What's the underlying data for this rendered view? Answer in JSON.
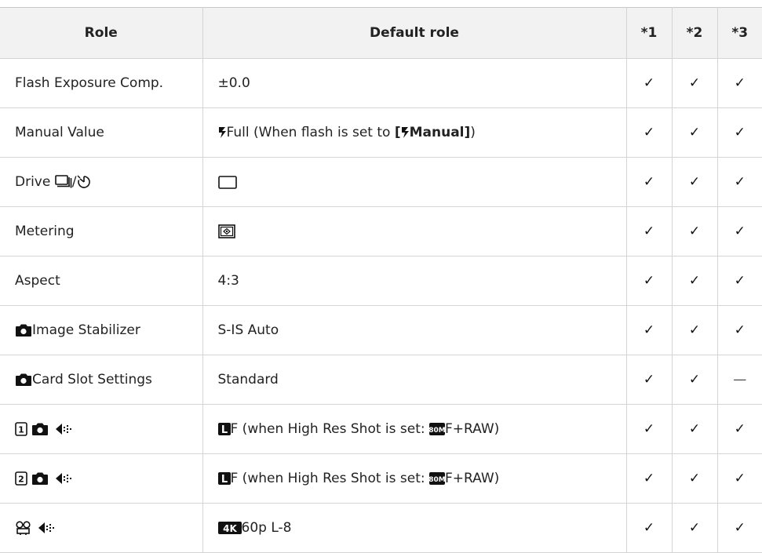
{
  "table": {
    "headers": [
      "Role",
      "Default role",
      "*1",
      "*2",
      "*3"
    ],
    "rows": [
      {
        "role": "Flash Exposure Comp.",
        "default": "±0.0",
        "marks": [
          "✓",
          "✓",
          "✓"
        ]
      },
      {
        "role": "Manual Value",
        "default_pre": "Full (When flash is set to ",
        "default_bold": "[Manual]",
        "default_post": ")",
        "marks": [
          "✓",
          "✓",
          "✓"
        ]
      },
      {
        "role": "Drive ",
        "role_sep": "/",
        "default": "",
        "marks": [
          "✓",
          "✓",
          "✓"
        ]
      },
      {
        "role": "Metering",
        "default": "",
        "marks": [
          "✓",
          "✓",
          "✓"
        ]
      },
      {
        "role": "Aspect",
        "default": "4:3",
        "marks": [
          "✓",
          "✓",
          "✓"
        ]
      },
      {
        "role": "Image Stabilizer",
        "default": "S-IS Auto",
        "marks": [
          "✓",
          "✓",
          "✓"
        ]
      },
      {
        "role": "Card Slot Settings",
        "default": "Standard",
        "marks": [
          "✓",
          "✓",
          "—"
        ]
      },
      {
        "role": "",
        "default_pre": "F (when High Res Shot is set: ",
        "default_post": "F+RAW)",
        "marks": [
          "✓",
          "✓",
          "✓"
        ]
      },
      {
        "role": "",
        "default_pre": "F (when High Res Shot is set: ",
        "default_post": "F+RAW)",
        "marks": [
          "✓",
          "✓",
          "✓"
        ]
      },
      {
        "role": "",
        "default": "60p L-8",
        "marks": [
          "✓",
          "✓",
          "✓"
        ]
      }
    ]
  },
  "icons": {
    "flash": "flash-icon",
    "drive_sequential": "sequential-shooting-icon",
    "self_timer": "self-timer-icon",
    "single_frame": "single-frame-icon",
    "metering": "digital-esp-metering-icon",
    "camera": "still-camera-icon",
    "card_slot_1": "card-slot-1-icon",
    "card_slot_2": "card-slot-2-icon",
    "image_quality": "image-quality-icon",
    "large_size": "large-size-icon",
    "size_80m": "80m-size-icon",
    "movie": "movie-icon",
    "resolution_4k": "4k-icon"
  },
  "badges": {
    "large": "L",
    "size_80m": "80M",
    "res_4k": "4K",
    "slot1": "1",
    "slot2": "2"
  }
}
